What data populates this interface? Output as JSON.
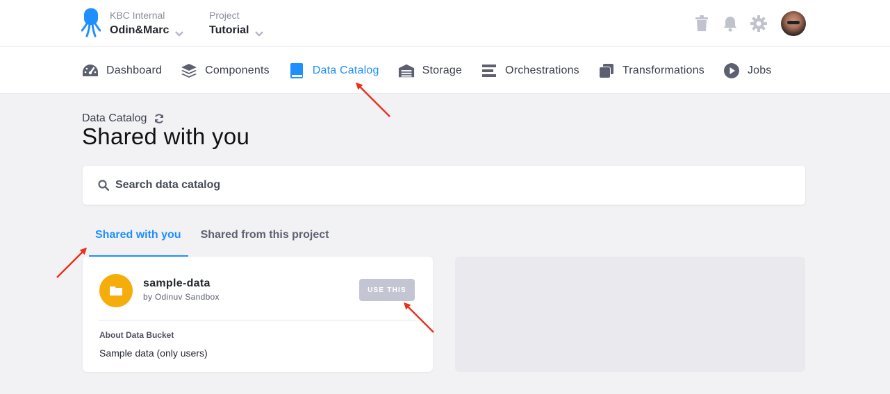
{
  "header": {
    "org_label": "KBC Internal",
    "org_name": "Odin&Marc",
    "project_label": "Project",
    "project_name": "Tutorial",
    "icons": [
      "trash-icon",
      "bell-icon",
      "gear-icon",
      "avatar"
    ]
  },
  "nav": {
    "items": [
      {
        "label": "Dashboard",
        "icon": "gauge-icon"
      },
      {
        "label": "Components",
        "icon": "layers-icon"
      },
      {
        "label": "Data Catalog",
        "icon": "book-icon",
        "active": true
      },
      {
        "label": "Storage",
        "icon": "warehouse-icon"
      },
      {
        "label": "Orchestrations",
        "icon": "bars-icon"
      },
      {
        "label": "Transformations",
        "icon": "copy-icon"
      },
      {
        "label": "Jobs",
        "icon": "play-circle-icon"
      }
    ]
  },
  "page": {
    "breadcrumb": "Data Catalog",
    "title": "Shared with you"
  },
  "search": {
    "placeholder": "Search data catalog",
    "value": ""
  },
  "tabs": [
    {
      "label": "Shared with you",
      "active": true
    },
    {
      "label": "Shared from this project",
      "active": false
    }
  ],
  "bucket": {
    "name": "sample-data",
    "owner": "by Odinuv Sandbox",
    "button_label": "USE THIS",
    "about_label": "About Data Bucket",
    "description": "Sample data (only users)"
  },
  "colors": {
    "accent": "#1f8fff",
    "folder": "#f5ad0b",
    "button_disabled": "#c4c5d3",
    "annotation": "#e8321c",
    "background": "#f2f2f5"
  }
}
